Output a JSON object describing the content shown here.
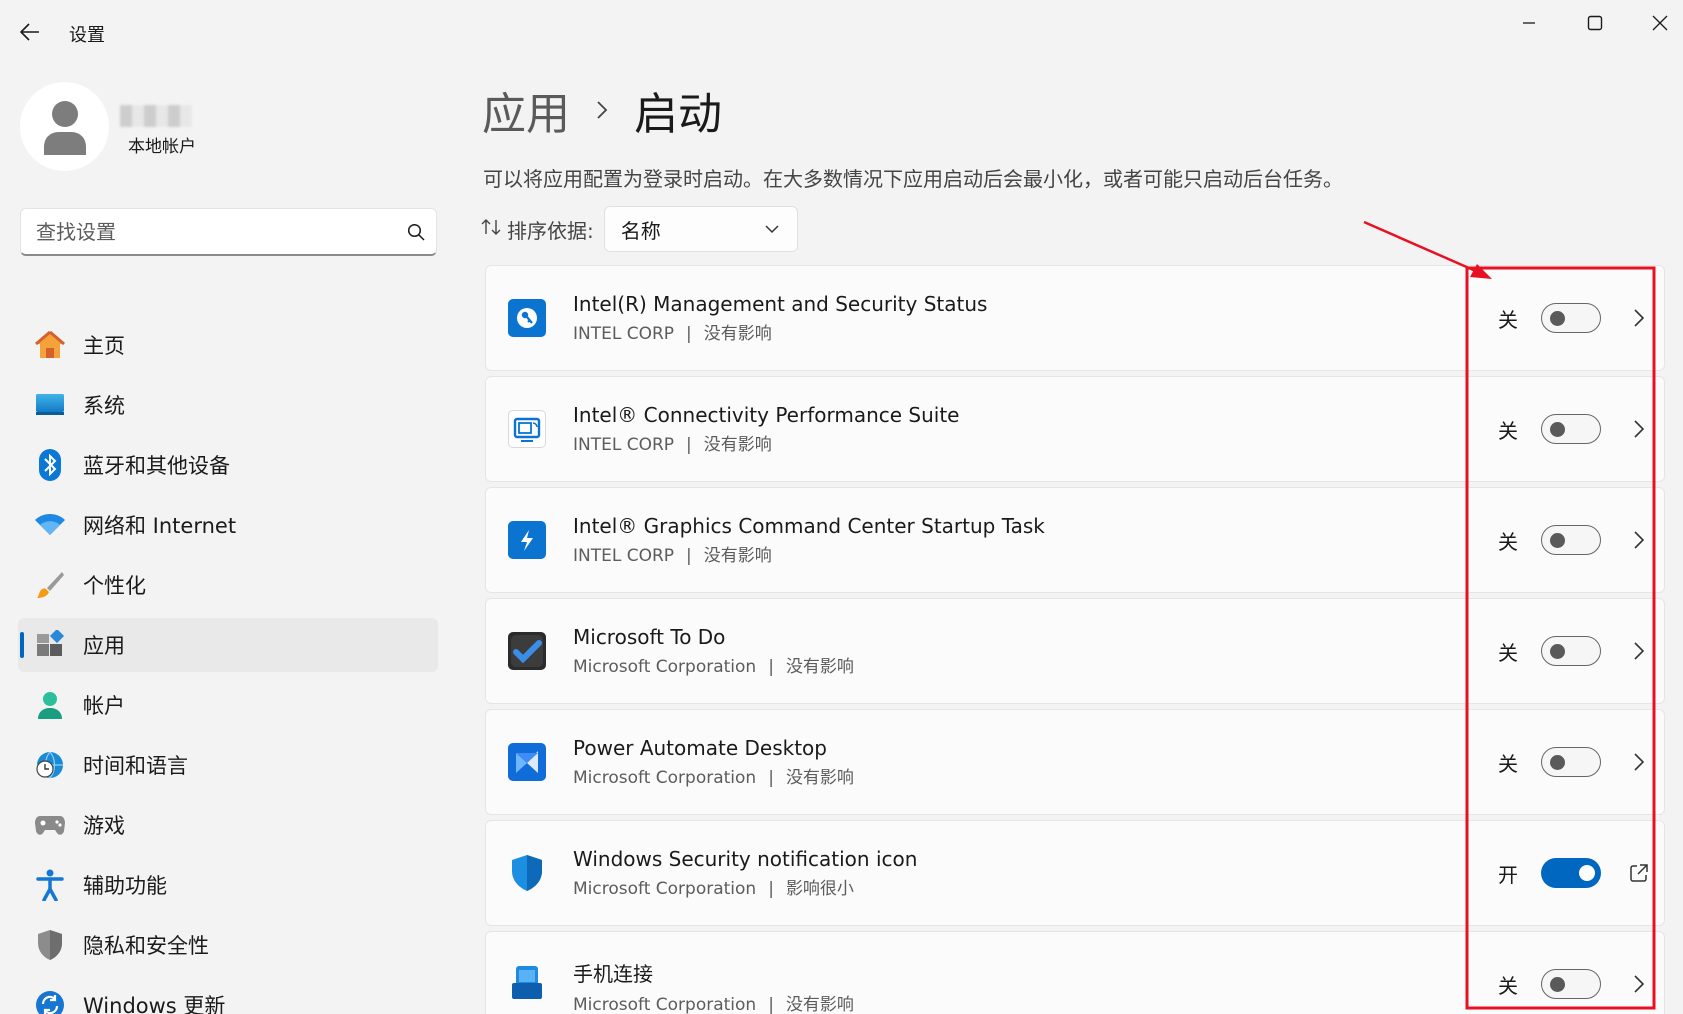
{
  "window": {
    "title": "设置"
  },
  "user": {
    "account_type": "本地帐户"
  },
  "search": {
    "placeholder": "查找设置"
  },
  "sidebar": {
    "items": [
      {
        "label": "主页",
        "icon": "home-icon"
      },
      {
        "label": "系统",
        "icon": "system-icon"
      },
      {
        "label": "蓝牙和其他设备",
        "icon": "bluetooth-icon"
      },
      {
        "label": "网络和 Internet",
        "icon": "wifi-icon"
      },
      {
        "label": "个性化",
        "icon": "brush-icon"
      },
      {
        "label": "应用",
        "icon": "apps-icon",
        "active": true
      },
      {
        "label": "帐户",
        "icon": "account-icon"
      },
      {
        "label": "时间和语言",
        "icon": "globe-clock-icon"
      },
      {
        "label": "游戏",
        "icon": "gamepad-icon"
      },
      {
        "label": "辅助功能",
        "icon": "accessibility-icon"
      },
      {
        "label": "隐私和安全性",
        "icon": "shield-icon"
      },
      {
        "label": "Windows 更新",
        "icon": "update-icon"
      }
    ]
  },
  "breadcrumb": {
    "parent": "应用",
    "current": "启动"
  },
  "description": "可以将应用配置为登录时启动。在大多数情况下应用启动后会最小化，或者可能只启动后台任务。",
  "sort": {
    "label": "排序依据:",
    "value": "名称"
  },
  "apps": [
    {
      "name": "Intel(R) Management and Security Status",
      "publisher": "INTEL CORP",
      "impact": "没有影响",
      "state": "关",
      "enabled": false,
      "icon": "intel-security-icon"
    },
    {
      "name": "Intel® Connectivity Performance Suite",
      "publisher": "INTEL CORP",
      "impact": "没有影响",
      "state": "关",
      "enabled": false,
      "icon": "intel-connectivity-icon"
    },
    {
      "name": "Intel® Graphics Command Center Startup Task",
      "publisher": "INTEL CORP",
      "impact": "没有影响",
      "state": "关",
      "enabled": false,
      "icon": "intel-graphics-icon"
    },
    {
      "name": "Microsoft To Do",
      "publisher": "Microsoft Corporation",
      "impact": "没有影响",
      "state": "关",
      "enabled": false,
      "icon": "todo-icon"
    },
    {
      "name": "Power Automate Desktop",
      "publisher": "Microsoft Corporation",
      "impact": "没有影响",
      "state": "关",
      "enabled": false,
      "icon": "power-automate-icon"
    },
    {
      "name": "Windows Security notification icon",
      "publisher": "Microsoft Corporation",
      "impact": "影响很小",
      "state": "开",
      "enabled": true,
      "icon": "windows-security-icon"
    },
    {
      "name": "手机连接",
      "publisher": "Microsoft Corporation",
      "impact": "没有影响",
      "state": "关",
      "enabled": false,
      "icon": "phone-link-icon"
    }
  ],
  "colors": {
    "accent": "#0067c0",
    "annotation": "#e81123"
  }
}
